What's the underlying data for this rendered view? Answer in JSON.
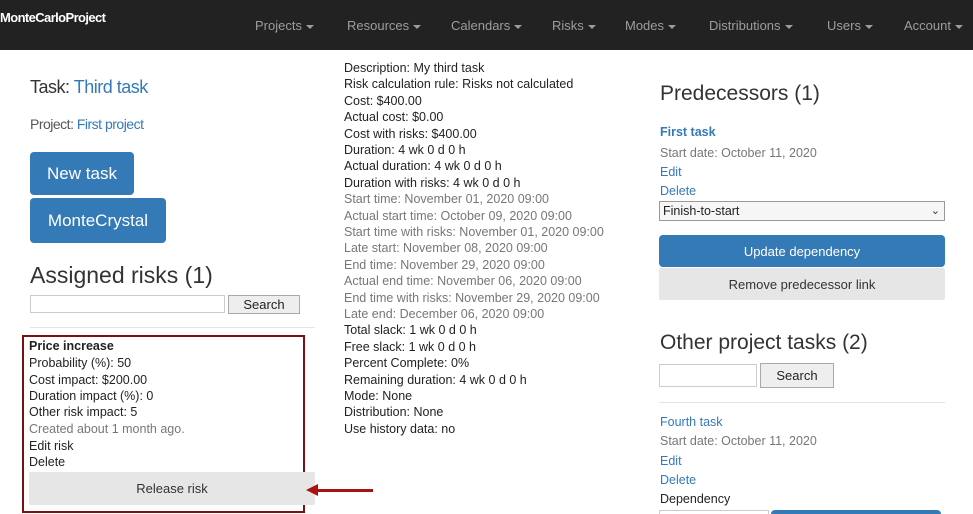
{
  "navbar": {
    "brand": "MonteCarloProject",
    "items": [
      {
        "label": "Projects"
      },
      {
        "label": "Resources"
      },
      {
        "label": "Calendars"
      },
      {
        "label": "Risks"
      },
      {
        "label": "Modes"
      },
      {
        "label": "Distributions"
      },
      {
        "label": "Users"
      },
      {
        "label": "Account"
      }
    ]
  },
  "task": {
    "label": "Task:",
    "name": "Third task",
    "project_label": "Project:",
    "project_name": "First project"
  },
  "buttons": {
    "new_task": "New task",
    "montecrystal": "MonteCrystal",
    "release_risk": "Release risk",
    "update_dependency": "Update dependency",
    "remove_predecessor": "Remove predecessor link",
    "search": "Search"
  },
  "assigned_risks": {
    "heading": "Assigned risks (1)",
    "search_value": "",
    "risk": {
      "name": "Price increase",
      "probability": "Probability (%): 50",
      "cost_impact": "Cost impact: $200.00",
      "duration_impact": "Duration impact (%): 0",
      "other_impact": "Other risk impact: 5",
      "created": "Created about 1 month ago.",
      "edit": "Edit risk",
      "delete": "Delete"
    }
  },
  "details": [
    {
      "text": "Description: My third task",
      "muted": false
    },
    {
      "text": "Risk calculation rule: Risks not calculated",
      "muted": false
    },
    {
      "text": "Cost: $400.00",
      "muted": false
    },
    {
      "text": "Actual cost: $0.00",
      "muted": false
    },
    {
      "text": "Cost with risks: $400.00",
      "muted": false
    },
    {
      "text": "Duration: 4 wk 0 d 0 h",
      "muted": false
    },
    {
      "text": "Actual duration: 4 wk 0 d 0 h",
      "muted": false
    },
    {
      "text": "Duration with risks: 4 wk 0 d 0 h",
      "muted": false
    },
    {
      "text": "Start time: November 01, 2020 09:00",
      "muted": true
    },
    {
      "text": "Actual start time: October 09, 2020 09:00",
      "muted": true
    },
    {
      "text": "Start time with risks: November 01, 2020 09:00",
      "muted": true
    },
    {
      "text": "Late start: November 08, 2020 09:00",
      "muted": true
    },
    {
      "text": "End time: November 29, 2020 09:00",
      "muted": true
    },
    {
      "text": "Actual end time: November 06, 2020 09:00",
      "muted": true
    },
    {
      "text": "End time with risks: November 29, 2020 09:00",
      "muted": true
    },
    {
      "text": "Late end: December 06, 2020 09:00",
      "muted": true
    },
    {
      "text": "Total slack: 1 wk 0 d 0 h",
      "muted": false
    },
    {
      "text": "Free slack: 1 wk 0 d 0 h",
      "muted": false
    },
    {
      "text": "Percent Complete: 0%",
      "muted": false
    },
    {
      "text": "Remaining duration: 4 wk 0 d 0 h",
      "muted": false
    },
    {
      "text": "Mode: None",
      "muted": false
    },
    {
      "text": "Distribution: None",
      "muted": false
    },
    {
      "text": "Use history data: no",
      "muted": false
    }
  ],
  "predecessors": {
    "heading": "Predecessors (1)",
    "task_name": "First task",
    "start_date": "Start date: October 11, 2020",
    "edit": "Edit",
    "delete": "Delete",
    "dependency_type": "Finish-to-start"
  },
  "other_tasks": {
    "heading": "Other project tasks (2)",
    "search_value": "",
    "task_name": "Fourth task",
    "start_date": "Start date: October 11, 2020",
    "edit": "Edit",
    "delete": "Delete",
    "dependency_label": "Dependency"
  },
  "colors": {
    "navbar_bg": "#222222",
    "primary": "#337ab7",
    "highlight_border": "#7b1010",
    "arrow": "#aa1111"
  }
}
